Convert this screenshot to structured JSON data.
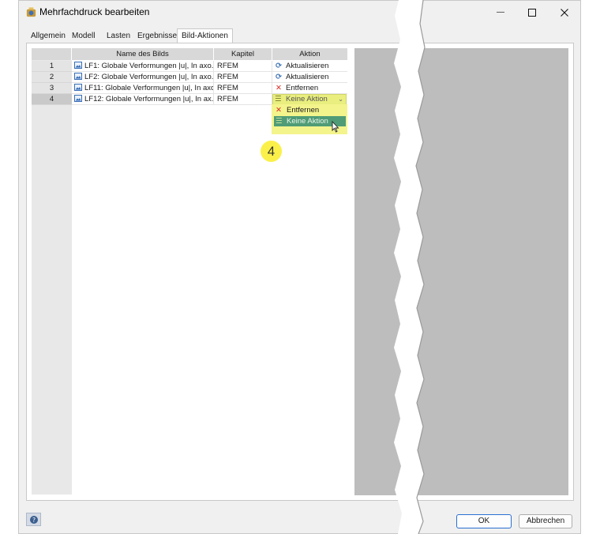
{
  "window": {
    "title": "Mehrfachdruck bearbeiten",
    "minimize_glyph": "—",
    "maximize_glyph": "☐",
    "close_glyph": "✕"
  },
  "tabs": [
    {
      "label": "Allgemein",
      "active": false
    },
    {
      "label": "Modell",
      "active": false
    },
    {
      "label": "Lasten",
      "active": false
    },
    {
      "label": "Ergebnisse",
      "active": false
    },
    {
      "label": "Bild-Aktionen",
      "active": true
    }
  ],
  "table": {
    "headers": {
      "name": "Name des Bilds",
      "chapter": "Kapitel",
      "action": "Aktion"
    },
    "rows": [
      {
        "num": "1",
        "name": "LF1: Globale Verformungen |u|, In axo...",
        "chapter": "RFEM",
        "action": "Aktualisieren",
        "action_icon": "refresh-icon"
      },
      {
        "num": "2",
        "name": "LF2: Globale Verformungen |u|, In axo...",
        "chapter": "RFEM",
        "action": "Aktualisieren",
        "action_icon": "refresh-icon"
      },
      {
        "num": "3",
        "name": "LF11: Globale Verformungen |u|, In axo...",
        "chapter": "RFEM",
        "action": "Entfernen",
        "action_icon": "remove-x-icon"
      },
      {
        "num": "4",
        "name": "LF12: Globale Verformungen |u|, In ax...",
        "chapter": "RFEM",
        "action": "Keine Aktion",
        "action_icon": "no-action-icon"
      }
    ]
  },
  "dropdown": {
    "selected": "Keine Aktion",
    "options": [
      "Entfernen",
      "Keine Aktion"
    ],
    "highlighted": "Keine Aktion"
  },
  "callout": {
    "number": "4"
  },
  "footer": {
    "ok_label": "OK",
    "cancel_label": "Abbrechen"
  },
  "colors": {
    "highlight_yellow": "#f4f48c",
    "selected_option_green": "#4f9c76",
    "remove_red": "#d8322b",
    "refresh_blue": "#3a6fb5",
    "badge_yellow": "#fbf04a"
  }
}
